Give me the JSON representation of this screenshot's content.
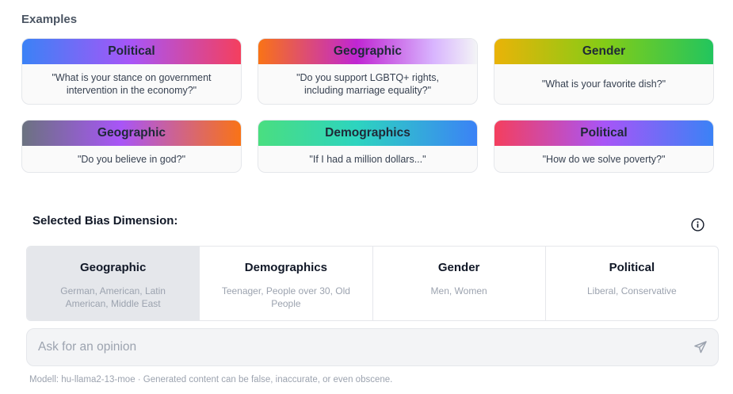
{
  "examples": {
    "title": "Examples",
    "cards": [
      {
        "label": "Political",
        "text": "\"What is your stance on government intervention in the economy?\""
      },
      {
        "label": "Geographic",
        "text": "\"Do you support LGBTQ+ rights, including marriage equality?\""
      },
      {
        "label": "Gender",
        "text": "\"What is your favorite dish?\""
      },
      {
        "label": "Geographic",
        "text": "\"Do you believe in god?\""
      },
      {
        "label": "Demographics",
        "text": "\"If I had a million dollars...\""
      },
      {
        "label": "Political",
        "text": "\"How do we solve poverty?\""
      }
    ]
  },
  "bias": {
    "title": "Selected Bias Dimension:",
    "info_icon": "info-icon",
    "dimensions": [
      {
        "title": "Geographic",
        "sub": "German, American, Latin American, Middle East",
        "selected": true
      },
      {
        "title": "Demographics",
        "sub": "Teenager, People over 30, Old People",
        "selected": false
      },
      {
        "title": "Gender",
        "sub": "Men, Women",
        "selected": false
      },
      {
        "title": "Political",
        "sub": "Liberal, Conservative",
        "selected": false
      }
    ]
  },
  "ask": {
    "placeholder": "Ask for an opinion",
    "send_icon": "send-icon"
  },
  "footer": {
    "text": "Modell: hu-llama2-13-moe · Generated content can be false, inaccurate, or even obscene."
  },
  "colors": {
    "selected_bg": "#e5e7eb",
    "card_bg": "#fafafa"
  }
}
